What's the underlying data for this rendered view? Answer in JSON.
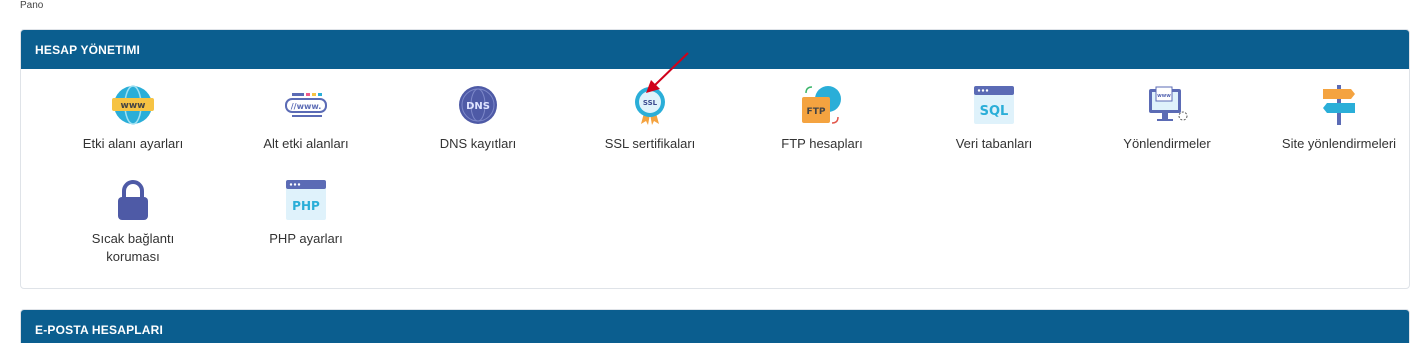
{
  "breadcrumb": "Pano",
  "panels": [
    {
      "title": "HESAP YÖNETIMI",
      "items": [
        {
          "label": "Etki alanı ayarları",
          "icon": "www-globe-icon"
        },
        {
          "label": "Alt etki alanları",
          "icon": "www-subdomain-icon"
        },
        {
          "label": "DNS kayıtları",
          "icon": "dns-icon"
        },
        {
          "label": "SSL sertifikaları",
          "icon": "ssl-badge-icon"
        },
        {
          "label": "FTP hesapları",
          "icon": "ftp-folder-icon"
        },
        {
          "label": "Veri tabanları",
          "icon": "sql-database-icon"
        },
        {
          "label": "Yönlendirmeler",
          "icon": "redirect-monitor-icon"
        },
        {
          "label": "Site yönlendirmeleri",
          "icon": "signpost-icon"
        },
        {
          "label": "Sıcak bağlantı koruması",
          "icon": "lock-icon"
        },
        {
          "label": "PHP ayarları",
          "icon": "php-icon"
        }
      ]
    },
    {
      "title": "E-POSTA HESAPLARI"
    }
  ],
  "colors": {
    "header": "#0b5e8f",
    "annotation_arrow": "#d0021b"
  }
}
